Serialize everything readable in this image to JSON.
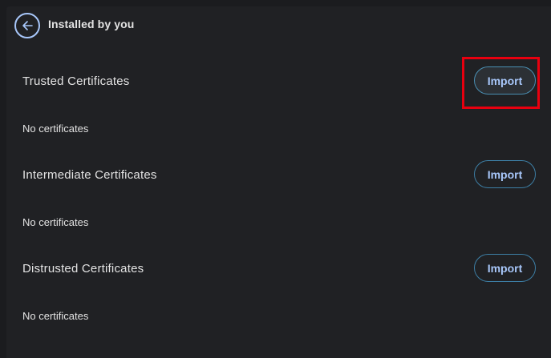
{
  "header": {
    "title": "Installed by you",
    "back_icon": "arrow-back-icon"
  },
  "sections": [
    {
      "title": "Trusted Certificates",
      "button_label": "Import",
      "status": "No certificates"
    },
    {
      "title": "Intermediate Certificates",
      "button_label": "Import",
      "status": "No certificates"
    },
    {
      "title": "Distrusted Certificates",
      "button_label": "Import",
      "status": "No certificates"
    }
  ],
  "colors": {
    "background": "#202124",
    "accent": "#a8c7fa",
    "button_border": "#3d7fa6",
    "highlight": "#e8000f"
  }
}
